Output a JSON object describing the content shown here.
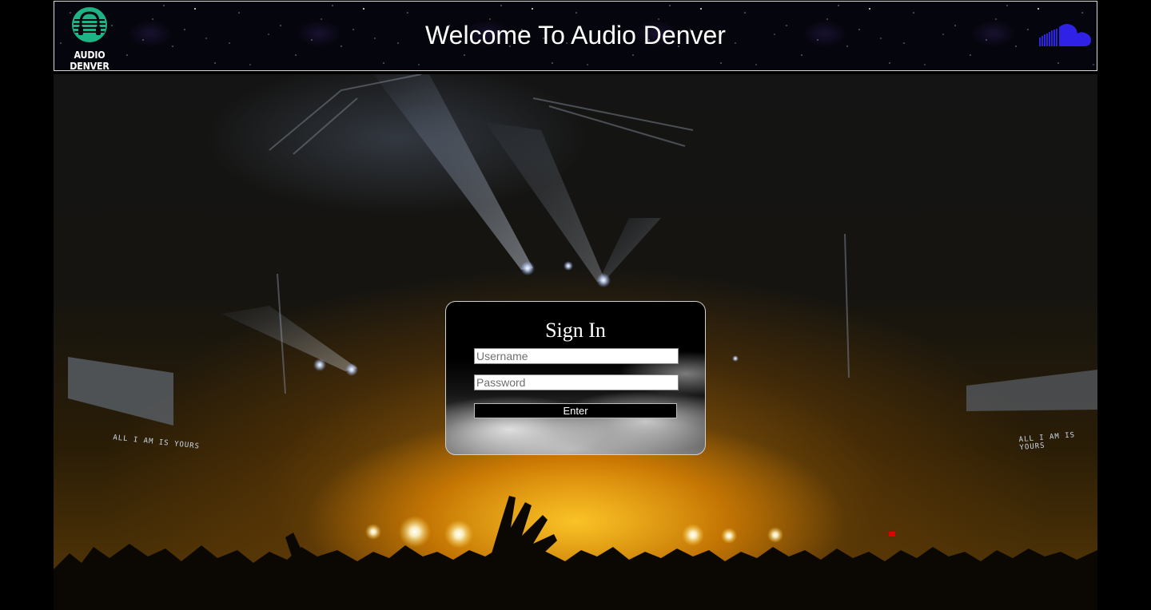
{
  "header": {
    "logo_text": "AUDIO DENVER",
    "title": "Welcome To Audio Denver",
    "cloud_icon": "soundcloud-cloud-icon"
  },
  "hero": {
    "screen_text_left": "ALL I AM IS YOURS",
    "screen_text_right": "ALL I AM IS YOURS"
  },
  "signin": {
    "title": "Sign In",
    "username_placeholder": "Username",
    "password_placeholder": "Password",
    "enter_label": "Enter"
  },
  "colors": {
    "logo_accent": "#1db385",
    "cloud_icon": "#2f22e6",
    "page_background": "#000000"
  }
}
